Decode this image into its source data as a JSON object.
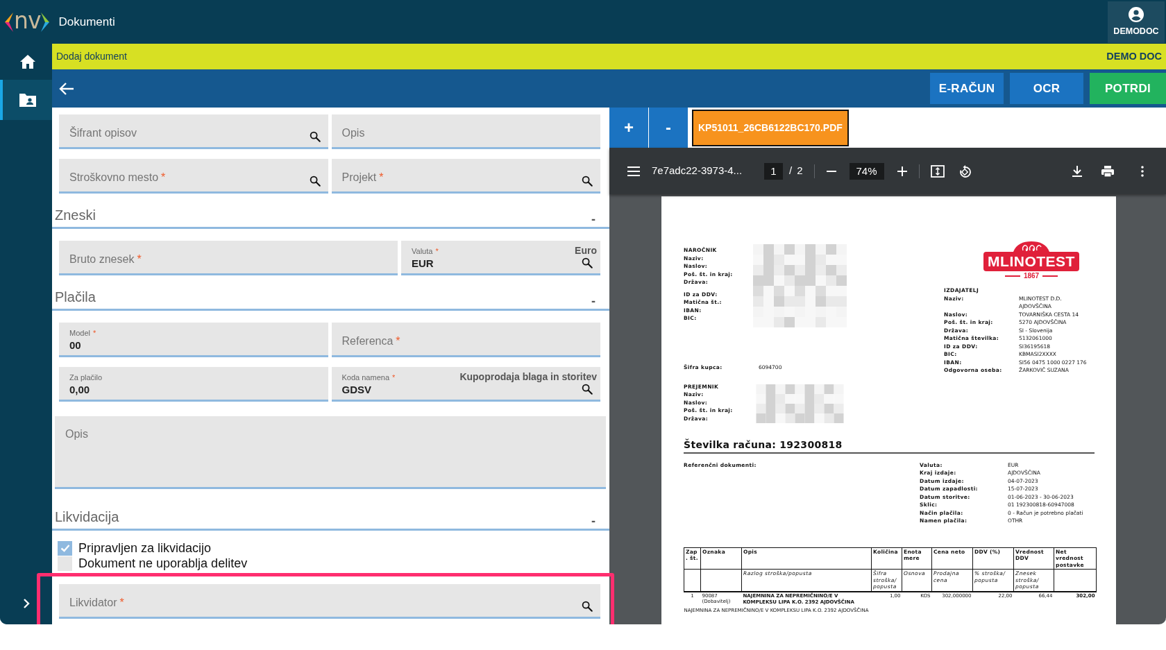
{
  "app": {
    "title": "Dokumenti",
    "logo_text": "nv",
    "user": "DEMODOC"
  },
  "sidebar": {
    "items": [
      {
        "kind": "home",
        "selected": false
      },
      {
        "kind": "documents",
        "selected": true
      }
    ]
  },
  "breadcrumb": {
    "title": "Dodaj dokument",
    "company": "DEMO DOC"
  },
  "toolbar": {
    "buttons": [
      {
        "label": "E-RAČUN",
        "kind": "primary"
      },
      {
        "label": "OCR",
        "kind": "primary"
      },
      {
        "label": "POTRDI",
        "kind": "success"
      }
    ]
  },
  "form": {
    "required_mark": "*",
    "blocks": [
      {
        "kind": "row",
        "fields": [
          {
            "label": "Šifrant opisov",
            "required": false,
            "search": true
          },
          {
            "label": "Opis",
            "required": false,
            "search": false
          }
        ]
      },
      {
        "kind": "row",
        "fields": [
          {
            "label": "Stroškovno mesto",
            "required": true,
            "search": true
          },
          {
            "label": "Projekt",
            "required": true,
            "search": true
          }
        ]
      },
      {
        "kind": "heading",
        "title": "Zneski",
        "toggle": "-"
      },
      {
        "kind": "wide_row",
        "fields": [
          {
            "label": "Bruto znesek",
            "required": true,
            "search": false
          },
          {
            "label": "Valuta",
            "required": true,
            "value": "EUR",
            "note": "Euro",
            "search": true
          }
        ]
      },
      {
        "kind": "heading",
        "title": "Plačila",
        "toggle": "-"
      },
      {
        "kind": "row",
        "fields": [
          {
            "label": "Model",
            "required": true,
            "value": "00",
            "search": false
          },
          {
            "label": "Referenca",
            "required": true,
            "search": false
          }
        ]
      },
      {
        "kind": "row",
        "fields": [
          {
            "label": "Za plačilo",
            "required": false,
            "value": "0,00",
            "search": false
          },
          {
            "label": "Koda namena",
            "required": true,
            "value": "GDSV",
            "note": "Kupoprodaja blaga in storitev",
            "search": true
          }
        ]
      },
      {
        "kind": "textarea",
        "label": "Opis"
      },
      {
        "kind": "heading",
        "title": "Likvidacija",
        "toggle": "-"
      },
      {
        "kind": "checkbox",
        "label": "Pripravljen za likvidacijo",
        "checked": true
      },
      {
        "kind": "checkbox",
        "label": "Dokument ne uporablja delitev",
        "checked": false
      },
      {
        "kind": "row",
        "highlighted": true,
        "fields": [
          {
            "label": "Likvidator",
            "required": true,
            "search": true
          }
        ]
      }
    ]
  },
  "viewer": {
    "add": "+",
    "remove": "-",
    "files": [
      {
        "name": "KP51011_26CB6122BC170.PDF",
        "selected": true
      }
    ],
    "pdf_toolbar": {
      "title": "7e7adc22-3973-4...",
      "page": "1",
      "separator": "/",
      "pages": "2",
      "zoom": "74%"
    },
    "document": {
      "buyer": {
        "heading": "NAROČNIK",
        "labels": [
          "Naziv:",
          "Naslov:",
          "Poš. št. in kraj:",
          "Država:"
        ],
        "labels_2": [
          "ID za DDV:",
          "Matična št.:",
          "IBAN:",
          "BIC:"
        ]
      },
      "logo": {
        "name": "MLINOTEST",
        "year": "1867"
      },
      "customer_code": {
        "label": "Šifra kupca:",
        "value": "6094700"
      },
      "recipient": {
        "heading": "PREJEMNIK",
        "labels": [
          "Naziv:",
          "Naslov:",
          "Poš. št. in kraj:",
          "Država:"
        ]
      },
      "issuer": {
        "heading": "IZDAJATELJ",
        "rows": [
          {
            "label": "Naziv:",
            "value": "MLINOTEST D.D. AJDOVŠČINA"
          },
          {
            "label": "Naslov:",
            "value": "TOVARNIŠKA CESTA 14"
          },
          {
            "label": "Poš. št. in kraj:",
            "value": "5270 AJDOVŠČINA"
          },
          {
            "label": "Država:",
            "value": "SI - Slovenija"
          },
          {
            "label": "Matična številka:",
            "value": "5132061000"
          },
          {
            "label": "ID za DDV:",
            "value": "SI36195618"
          },
          {
            "label": "BIC:",
            "value": "KBMASI2XXXX"
          },
          {
            "label": "IBAN:",
            "value": "SI56 0475 1000 0227 176"
          },
          {
            "label": "Odgovorna oseba:",
            "value": "ŽARKOVIČ SUZANA"
          }
        ]
      },
      "invoice_number": {
        "label": "Številka računa:",
        "value": "192300818"
      },
      "references": {
        "label": "Referenčni dokumenti:"
      },
      "details": [
        {
          "label": "Valuta:",
          "value": "EUR"
        },
        {
          "label": "Kraj izdaje:",
          "value": "AJDOVŠČINA"
        },
        {
          "label": "Datum izdaje:",
          "value": "04-07-2023"
        },
        {
          "label": "Datum zapadlosti:",
          "value": "15-07-2023"
        },
        {
          "label": "Datum storitve:",
          "value": "01-06-2023 - 30-06-2023"
        },
        {
          "label": "Sklic:",
          "value": "01 192300818-60947008"
        },
        {
          "label": "Način plačila:",
          "value": "0 - Račun je potrebno plačati"
        },
        {
          "label": "Namen plačila:",
          "value": "OTHR"
        }
      ],
      "table": {
        "columns": [
          "Zap. št.",
          "Oznaka",
          "Opis",
          "Količina",
          "Enota mere",
          "Cena neto",
          "DDV (%)",
          "Vrednost DDV",
          "Net vrednost postavke"
        ],
        "subheaders": [
          {
            "kind": "empty"
          },
          {
            "kind": "empty"
          },
          {
            "kind": "text",
            "text": "Razlog stroška/popusta"
          },
          {
            "kind": "text",
            "text": "Šifra stroška/ popusta"
          },
          {
            "kind": "text",
            "text": "Osnova"
          },
          {
            "kind": "text",
            "text": "Prodajna cena"
          },
          {
            "kind": "text",
            "text": "% stroška/ popusta"
          },
          {
            "kind": "text",
            "text": "Znesek stroška/ popusta"
          },
          {
            "kind": "empty"
          }
        ],
        "rows": [
          {
            "cells": [
              "1",
              "90087",
              "NAJEMNINA ZA NEPREMIČNINO/E V KOMPLEKSU LIPA K.O. 2392 AJDOVŠČINA",
              "1,00",
              "KOS",
              "302,000000",
              "22,00",
              "66,44",
              "302,00"
            ],
            "code_note": "(Dobavitelj)",
            "line_2": "NAJEMNINA ZA NEPREMIČNINO/E V KOMPLEKSU LIPA K.O. 2392 AJDOVŠČINA"
          }
        ]
      }
    }
  }
}
